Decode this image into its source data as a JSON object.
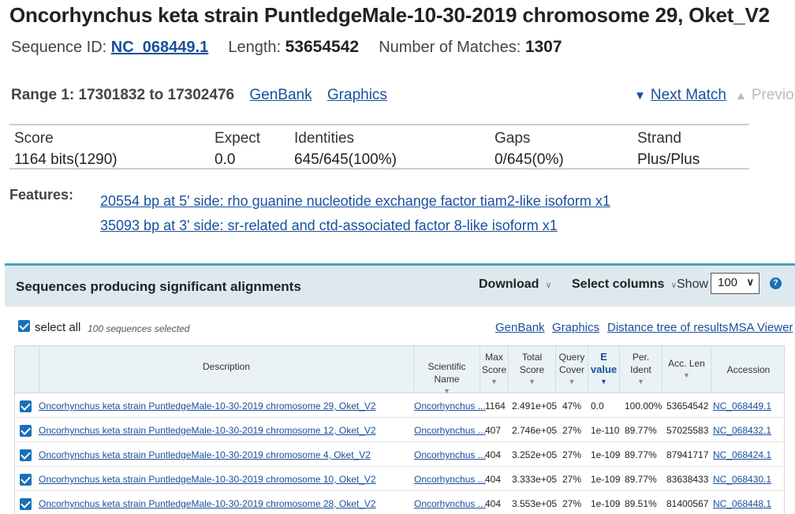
{
  "header": {
    "title": "Oncorhynchus keta strain PuntledgeMale-10-30-2019 chromosome 29, Oket_V2",
    "seq_id_label": "Sequence ID:",
    "seq_id": "NC_068449.1",
    "length_label": "Length:",
    "length": "53654542",
    "matches_label": "Number of Matches:",
    "matches": "1307"
  },
  "range": {
    "label": "Range 1: 17301832 to 17302476",
    "genbank": "GenBank",
    "graphics": "Graphics",
    "next_match": "Next Match",
    "previous": "Previo"
  },
  "stats": {
    "headers": [
      "Score",
      "Expect",
      "Identities",
      "Gaps",
      "Strand"
    ],
    "values": [
      "1164 bits(1290)",
      "0.0",
      "645/645(100%)",
      "0/645(0%)",
      "Plus/Plus"
    ]
  },
  "features": {
    "label": "Features:",
    "items": [
      "20554 bp at 5' side: rho guanine nucleotide exchange factor tiam2-like isoform x1",
      "35093 bp at 3' side: sr-related and ctd-associated factor 8-like isoform x1"
    ]
  },
  "panel": {
    "title": "Sequences producing significant alignments",
    "download": "Download",
    "select_columns": "Select columns",
    "show_label": "Show",
    "show_value": "100",
    "help": "?",
    "select_all": "select all",
    "selected_count": "100 sequences selected",
    "links": [
      "GenBank",
      "Graphics",
      "Distance tree of results",
      "MSA Viewer"
    ]
  },
  "table": {
    "headers": {
      "description": "Description",
      "scientific": "Scientific Name",
      "max1": "Max",
      "max2": "Score",
      "total1": "Total",
      "total2": "Score",
      "query1": "Query",
      "query2": "Cover",
      "e1": "E",
      "e2": "value",
      "per1": "Per.",
      "per2": "Ident",
      "acclen": "Acc. Len",
      "accession": "Accession"
    },
    "rows": [
      {
        "desc": "Oncorhynchus keta strain PuntledgeMale-10-30-2019 chromosome 29, Oket_V2",
        "sci": "Oncorhynchus ...",
        "max": "1164",
        "total": "2.491e+05",
        "cover": "47%",
        "e": "0.0",
        "ident": "100.00%",
        "acclen": "53654542",
        "acc": "NC_068449.1"
      },
      {
        "desc": "Oncorhynchus keta strain PuntledgeMale-10-30-2019 chromosome 12, Oket_V2",
        "sci": "Oncorhynchus ...",
        "max": "407",
        "total": "2.746e+05",
        "cover": "27%",
        "e": "1e-110",
        "ident": "89.77%",
        "acclen": "57025583",
        "acc": "NC_068432.1"
      },
      {
        "desc": "Oncorhynchus keta strain PuntledgeMale-10-30-2019 chromosome 4, Oket_V2",
        "sci": "Oncorhynchus ...",
        "max": "404",
        "total": "3.252e+05",
        "cover": "27%",
        "e": "1e-109",
        "ident": "89.77%",
        "acclen": "87941717",
        "acc": "NC_068424.1"
      },
      {
        "desc": "Oncorhynchus keta strain PuntledgeMale-10-30-2019 chromosome 10, Oket_V2",
        "sci": "Oncorhynchus ...",
        "max": "404",
        "total": "3.333e+05",
        "cover": "27%",
        "e": "1e-109",
        "ident": "89.77%",
        "acclen": "83638433",
        "acc": "NC_068430.1"
      },
      {
        "desc": "Oncorhynchus keta strain PuntledgeMale-10-30-2019 chromosome 28, Oket_V2",
        "sci": "Oncorhynchus ...",
        "max": "404",
        "total": "3.553e+05",
        "cover": "27%",
        "e": "1e-109",
        "ident": "89.51%",
        "acclen": "81400567",
        "acc": "NC_068448.1"
      }
    ]
  }
}
